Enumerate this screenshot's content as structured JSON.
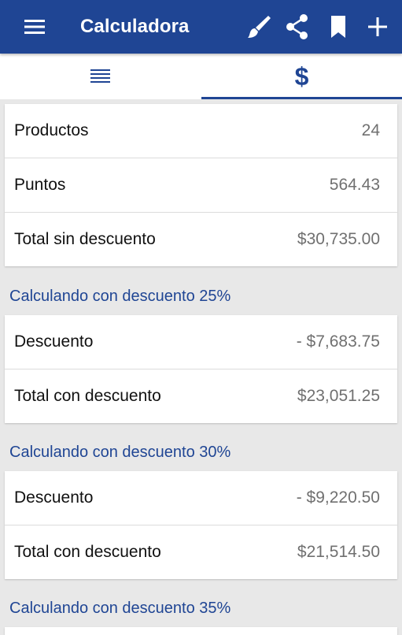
{
  "appbar": {
    "title": "Calculadora",
    "menu_icon": "menu-icon",
    "actions": [
      "brush-icon",
      "share-icon",
      "bookmark-icon",
      "add-icon"
    ]
  },
  "tabs": [
    {
      "icon": "list-icon",
      "selected": false
    },
    {
      "icon": "dollar-icon",
      "label": "$",
      "selected": true
    }
  ],
  "summary": {
    "rows": [
      {
        "label": "Productos",
        "value": "24"
      },
      {
        "label": "Puntos",
        "value": "564.43"
      },
      {
        "label": "Total sin descuento",
        "value": "$30,735.00"
      }
    ]
  },
  "discounts": [
    {
      "title": "Calculando con descuento 25%",
      "rows": [
        {
          "label": "Descuento",
          "value": "- $7,683.75"
        },
        {
          "label": "Total con descuento",
          "value": "$23,051.25"
        }
      ]
    },
    {
      "title": "Calculando con descuento 30%",
      "rows": [
        {
          "label": "Descuento",
          "value": "- $9,220.50"
        },
        {
          "label": "Total con descuento",
          "value": "$21,514.50"
        }
      ]
    },
    {
      "title": "Calculando con descuento 35%",
      "rows": []
    }
  ],
  "colors": {
    "primary": "#1f4594",
    "background": "#e8e8e8",
    "value_text": "#707070"
  }
}
